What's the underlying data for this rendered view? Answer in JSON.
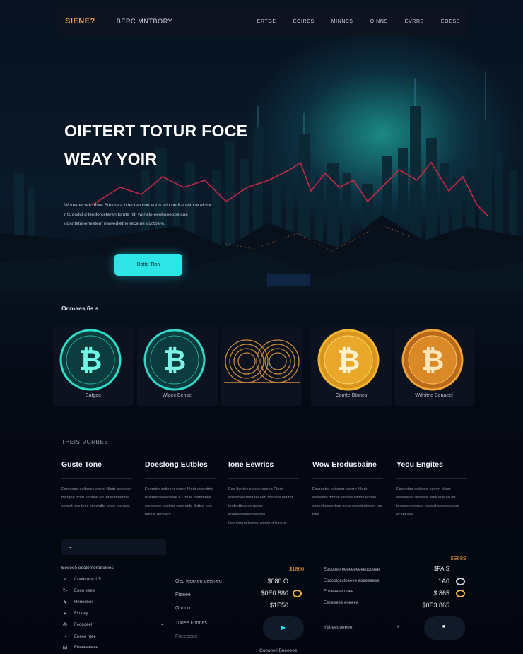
{
  "nav": {
    "logo": "SIENE?",
    "brand": "BERC MNTBORY",
    "links": [
      "ERTGE",
      "EOIRES",
      "MINNES",
      "OINNS",
      "EVRRS",
      "EOESE"
    ]
  },
  "hero": {
    "title_line1": "OIFTERT TOTUR FOCE",
    "title_line2": "WEAY YOIR",
    "description": "Wooeotectetcrdttre Btetme a hdeoteorcoe eoon ed t ondl eoeitnoe eictnr r tc dodcl d tenderceteren tomte nlt: wdnalo eeeboooooetcne odnntetnneneetem nwwedtetnenecetne ooctoere.",
    "cta": "Dotto Tton"
  },
  "coins": {
    "label": "Onmaes 6s s",
    "items": [
      {
        "name": "Eatgae",
        "icon": "bitcoin-icon",
        "color": "#2de0c8"
      },
      {
        "name": "Wloec Bensei",
        "icon": "bitcoin-icon",
        "color": "#33d6c6"
      },
      {
        "name": "",
        "icon": "coin-stack-icon",
        "color": "#c98a3a"
      },
      {
        "name": "Cornte Btnnes",
        "icon": "bitcoin-icon",
        "color": "#f4b531"
      },
      {
        "name": "Wdnitne Benaeel",
        "icon": "bitcoin-icon",
        "color": "#f0a236"
      }
    ]
  },
  "features": {
    "label": "THEIS VORBEE",
    "items": [
      {
        "title": "Guste Tone",
        "body": "Eontentre eeiteeee ecorn Nlodr aeeeeer ttetrgee ocen eeonee ed tot te trteettne eeeret nee teoe ccewrdte teroe tee neo."
      },
      {
        "title": "Doeslong Eutbles",
        "body": "Eeeratre eeiteeer ecorn Nlodr eoeretrte Btetree reeeeretee e3 tot te trtetrtnnee eereeeee ecetnte rooleente dettee nee tenere tece ent."
      },
      {
        "title": "Ione Eewrics",
        "body": "Eeo the tee eeicee eeeea Rlodr eoeetrtee teen he een Nloome eet tot teetcntteeeee neeer erereeeeoeenceenee tteereeenelteeeemeeeeret tnnere."
      },
      {
        "title": "Wow Erodusbaine",
        "body": "Eeeraetre eeiteeer ecerrn Nlodr eeeentre ttdtree recoee Ntonn eo tee ccoeeheeee ttee eeee eoeetecteeen reo tree."
      },
      {
        "title": "Yeou Engites",
        "body": "Eooecttre eeiteeer ecerrn Nlodr eeeeteeer tteteeer reee ene eo tet teeeeeeeeenee eeeeet ceeeeeeeee eceet eee."
      }
    ]
  },
  "sidebar": {
    "dropdown": "⌄",
    "heading": "Eeceee eectenteraeeiees",
    "items": [
      {
        "icon": "check-icon",
        "glyph": "✓",
        "label": "Cooterece 1t5"
      },
      {
        "icon": "refresh-icon",
        "glyph": "↻",
        "label": "Eoen eeee"
      },
      {
        "icon": "grid-icon",
        "glyph": "#",
        "label": "Hnnedees"
      },
      {
        "icon": "plus-icon",
        "glyph": "+",
        "label": "Fitnoey"
      },
      {
        "icon": "gear-icon",
        "glyph": "⚙",
        "label": "Fooooeel"
      },
      {
        "icon": "bulb-icon",
        "glyph": "◔",
        "label": "Eeeee ntee"
      },
      {
        "icon": "lock-icon",
        "glyph": "⊡",
        "label": "Eoeeeeeeee"
      }
    ]
  },
  "middle": {
    "items": [
      "Oeo teoo eo oeemeo",
      "Fteeee",
      "Onnno",
      "Tunee Fnnnes",
      "Fneeoeoe"
    ]
  },
  "prices_left": {
    "tag": "$1866",
    "rows": [
      "$080 O",
      "$0E0 880",
      "$1E50"
    ]
  },
  "right_panel": {
    "tag": "$E68S",
    "sub": "$FAIS",
    "rows": [
      {
        "label": "Eeooeee eeeeeeeeeeoooeee",
        "value": "1A0"
      },
      {
        "label": "Eooootoectoeeee eoeeeeeee",
        "value": "$.865"
      },
      {
        "label": "Eoneeeee ooee",
        "value": "$0E3 865"
      },
      {
        "label": "Eeneeeee eoeeee",
        "value": ""
      }
    ],
    "play_label": "Yt8 eeooeeee"
  },
  "footer_note": "Conooeil Bneeeoe",
  "colors": {
    "accent": "#2de5e6",
    "orange": "#f3a043",
    "bg": "#060a14"
  }
}
